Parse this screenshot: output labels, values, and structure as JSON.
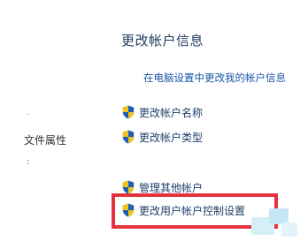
{
  "header": {
    "title": "更改帐户信息",
    "pc_settings_link": "在电脑设置中更改我的帐户信息"
  },
  "left_panel": {
    "frag1": "·",
    "frag2": "文件属性",
    "frag3": ":"
  },
  "tasks": [
    {
      "label": "更改帐户名称",
      "icon": "uac-shield-icon"
    },
    {
      "label": "更改帐户类型",
      "icon": "uac-shield-icon"
    },
    {
      "label": "管理其他帐户",
      "icon": "uac-shield-icon"
    },
    {
      "label": "更改用户帐户控制设置",
      "icon": "uac-shield-icon"
    }
  ],
  "colors": {
    "highlight": "#e5323c",
    "link": "#1a56a8",
    "shield_blue": "#1d5fb8",
    "shield_yellow": "#f2c41c"
  }
}
